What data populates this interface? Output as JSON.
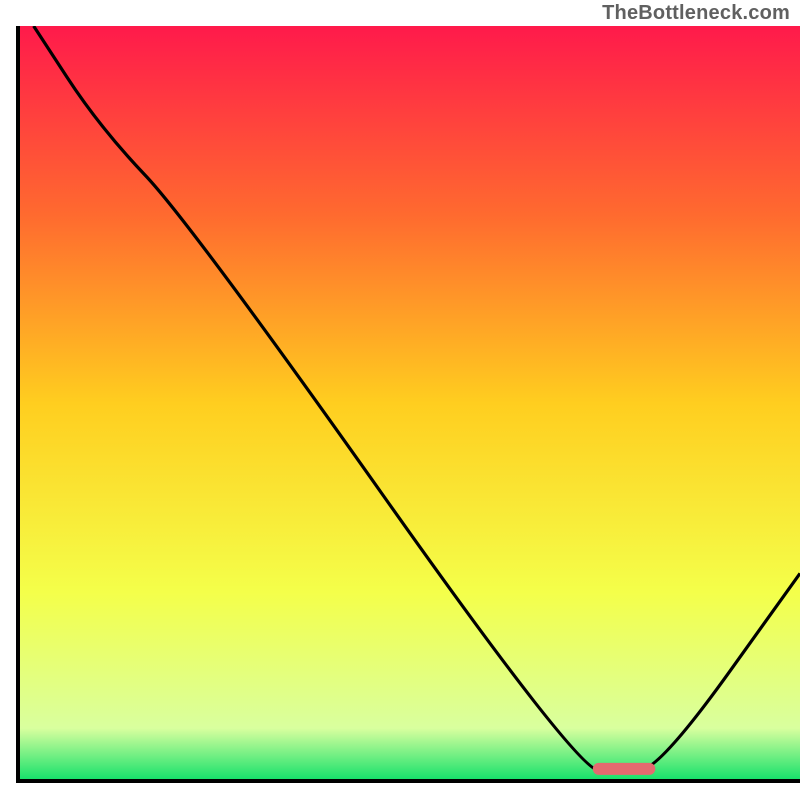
{
  "attribution": "TheBottleneck.com",
  "chart_data": {
    "type": "line",
    "title": "",
    "xlabel": "",
    "ylabel": "",
    "xlim": [
      0,
      100
    ],
    "ylim": [
      0,
      100
    ],
    "note": "Axes and gridlines not displayed in original image; values estimated from pixel positions on a 0–100 scale.",
    "background_gradient": {
      "stops": [
        {
          "pos": 0.0,
          "color": "#ff1a4b"
        },
        {
          "pos": 0.25,
          "color": "#ff6a2f"
        },
        {
          "pos": 0.5,
          "color": "#ffce1f"
        },
        {
          "pos": 0.75,
          "color": "#f4ff4a"
        },
        {
          "pos": 0.93,
          "color": "#d9ff9e"
        },
        {
          "pos": 1.0,
          "color": "#11e06a"
        }
      ]
    },
    "series": [
      {
        "name": "bottleneck-curve",
        "x": [
          2.0,
          10.5,
          22.0,
          71.5,
          77.0,
          82.0,
          100.0
        ],
        "y": [
          100.0,
          86.5,
          74.0,
          1.5,
          1.3,
          1.5,
          27.5
        ]
      }
    ],
    "marker": {
      "name": "optimal-segment",
      "x_start": 73.5,
      "x_end": 81.5,
      "y": 1.6,
      "color": "#e46a6f"
    },
    "frame_color": "#000000"
  }
}
